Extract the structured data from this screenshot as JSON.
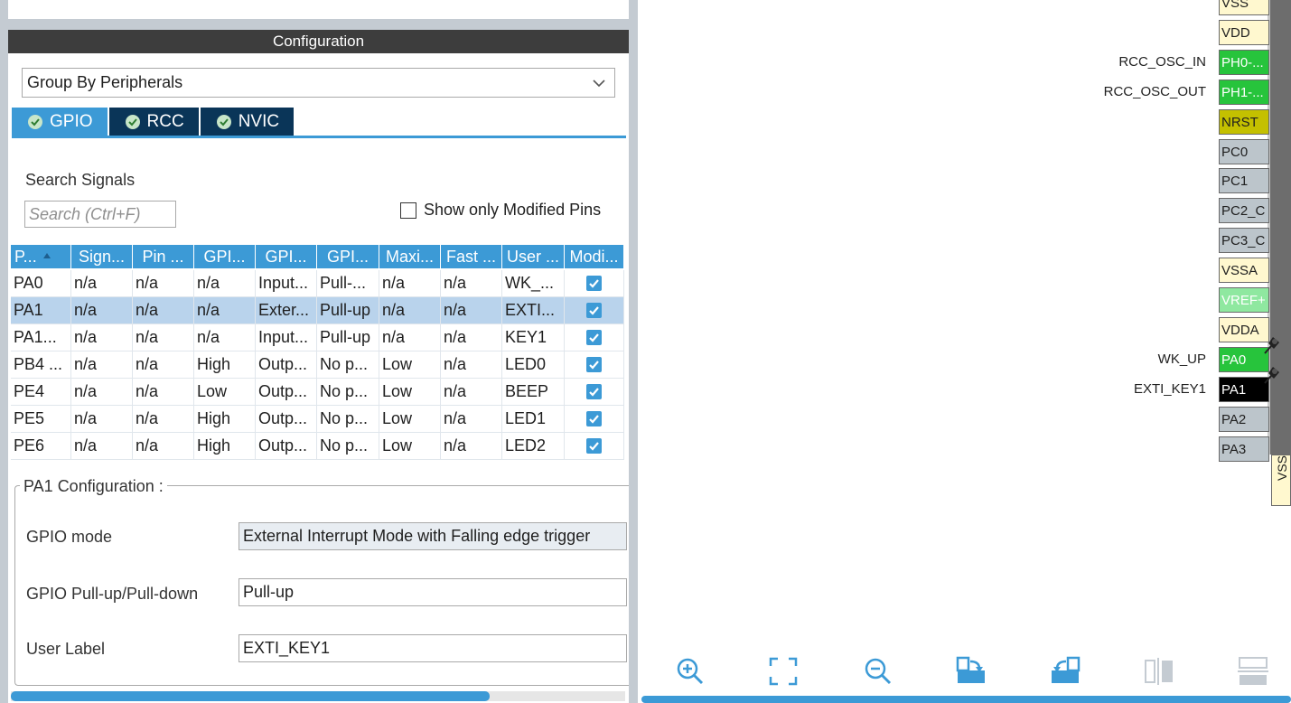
{
  "config_panel": {
    "title": "Configuration",
    "group_by": "Group By Peripherals",
    "tabs": [
      {
        "label": "GPIO",
        "active": true
      },
      {
        "label": "RCC",
        "active": false
      },
      {
        "label": "NVIC",
        "active": false
      }
    ],
    "search": {
      "label": "Search Signals",
      "placeholder": "Search (Ctrl+F)",
      "show_modified_label": "Show only Modified Pins",
      "show_modified_checked": false
    },
    "table": {
      "columns": [
        "P...",
        "Sign...",
        "Pin ...",
        "GPI...",
        "GPI...",
        "GPI...",
        "Maxi...",
        "Fast ...",
        "User ...",
        "Modi..."
      ],
      "rows": [
        {
          "pin": "PA0",
          "signal": "n/a",
          "pin_ctx": "n/a",
          "output_level": "n/a",
          "mode": "Input...",
          "pull": "Pull-...",
          "max_speed": "n/a",
          "fast": "n/a",
          "label": "WK_...",
          "modified": true,
          "selected": false
        },
        {
          "pin": "PA1",
          "signal": "n/a",
          "pin_ctx": "n/a",
          "output_level": "n/a",
          "mode": "Exter...",
          "pull": "Pull-up",
          "max_speed": "n/a",
          "fast": "n/a",
          "label": "EXTI...",
          "modified": true,
          "selected": true
        },
        {
          "pin": "PA1...",
          "signal": "n/a",
          "pin_ctx": "n/a",
          "output_level": "n/a",
          "mode": "Input...",
          "pull": "Pull-up",
          "max_speed": "n/a",
          "fast": "n/a",
          "label": "KEY1",
          "modified": true,
          "selected": false
        },
        {
          "pin": "PB4 ...",
          "signal": "n/a",
          "pin_ctx": "n/a",
          "output_level": "High",
          "mode": "Outp...",
          "pull": "No p...",
          "max_speed": "Low",
          "fast": "n/a",
          "label": "LED0",
          "modified": true,
          "selected": false
        },
        {
          "pin": "PE4",
          "signal": "n/a",
          "pin_ctx": "n/a",
          "output_level": "Low",
          "mode": "Outp...",
          "pull": "No p...",
          "max_speed": "Low",
          "fast": "n/a",
          "label": "BEEP",
          "modified": true,
          "selected": false
        },
        {
          "pin": "PE5",
          "signal": "n/a",
          "pin_ctx": "n/a",
          "output_level": "High",
          "mode": "Outp...",
          "pull": "No p...",
          "max_speed": "Low",
          "fast": "n/a",
          "label": "LED1",
          "modified": true,
          "selected": false
        },
        {
          "pin": "PE6",
          "signal": "n/a",
          "pin_ctx": "n/a",
          "output_level": "High",
          "mode": "Outp...",
          "pull": "No p...",
          "max_speed": "Low",
          "fast": "n/a",
          "label": "LED2",
          "modified": true,
          "selected": false
        }
      ]
    },
    "pin_config": {
      "title": "PA1 Configuration :",
      "gpio_mode_label": "GPIO mode",
      "gpio_mode_value": "External Interrupt Mode with Falling edge trigger",
      "pull_label": "GPIO Pull-up/Pull-down",
      "pull_value": "Pull-up",
      "user_label_label": "User Label",
      "user_label_value": "EXTI_KEY1"
    }
  },
  "pinout": {
    "pins": [
      {
        "name": "VSS",
        "signal": "",
        "color": "#fff8cf"
      },
      {
        "name": "VDD",
        "signal": "",
        "color": "#fff8cf"
      },
      {
        "name": "PH0-...",
        "signal": "RCC_OSC_IN",
        "color": "#27c43c"
      },
      {
        "name": "PH1-...",
        "signal": "RCC_OSC_OUT",
        "color": "#27c43c"
      },
      {
        "name": "NRST",
        "signal": "",
        "color": "#c4c000"
      },
      {
        "name": "PC0",
        "signal": "",
        "color": "#bcc5cb"
      },
      {
        "name": "PC1",
        "signal": "",
        "color": "#bcc5cb"
      },
      {
        "name": "PC2_C",
        "signal": "",
        "color": "#bcc5cb"
      },
      {
        "name": "PC3_C",
        "signal": "",
        "color": "#bcc5cb"
      },
      {
        "name": "VSSA",
        "signal": "",
        "color": "#fff8cf"
      },
      {
        "name": "VREF+",
        "signal": "",
        "color": "#8fe8a0"
      },
      {
        "name": "VDDA",
        "signal": "",
        "color": "#fff8cf"
      },
      {
        "name": "PA0",
        "signal": "WK_UP",
        "color": "#27c43c",
        "pinned": true
      },
      {
        "name": "PA1",
        "signal": "EXTI_KEY1",
        "color": "#000000",
        "pinned": true
      },
      {
        "name": "PA2",
        "signal": "",
        "color": "#bcc5cb"
      },
      {
        "name": "PA3",
        "signal": "",
        "color": "#bcc5cb"
      }
    ],
    "bottom_pin": "VSS",
    "toolbar": [
      "zoom-in-icon",
      "fit-screen-icon",
      "zoom-out-icon",
      "rotate-right-icon",
      "rotate-left-icon",
      "flip-horizontal-icon",
      "flip-vertical-icon"
    ]
  }
}
